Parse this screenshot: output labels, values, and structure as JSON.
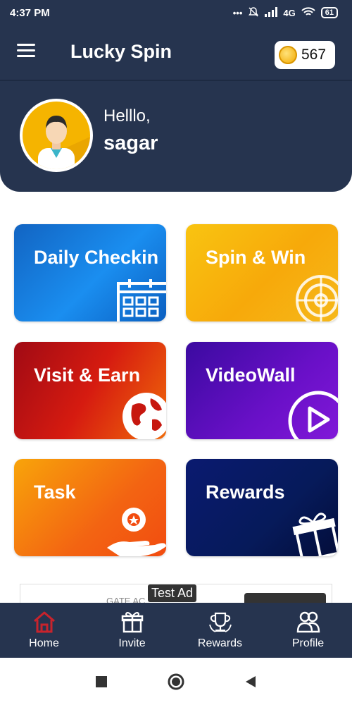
{
  "status_bar": {
    "time": "4:37 PM",
    "network": "4G",
    "battery": "61"
  },
  "header": {
    "title": "Lucky Spin",
    "coins": "567",
    "greeting": "Helllo,",
    "username": "sagar"
  },
  "cards": [
    {
      "label": "Daily Checkin",
      "icon": "calendar-icon"
    },
    {
      "label": "Spin & Win",
      "icon": "wheel-icon"
    },
    {
      "label": "Visit & Earn",
      "icon": "globe-icon"
    },
    {
      "label": "VideoWall",
      "icon": "play-icon"
    },
    {
      "label": "Task",
      "icon": "hand-badge-icon"
    },
    {
      "label": "Rewards",
      "icon": "gift-icon"
    }
  ],
  "ad": {
    "badge": "Test Ad",
    "text": "GATE AC"
  },
  "bottom_nav": [
    {
      "label": "Home",
      "icon": "home-icon",
      "active": true
    },
    {
      "label": "Invite",
      "icon": "gift-icon",
      "active": false
    },
    {
      "label": "Rewards",
      "icon": "trophy-icon",
      "active": false
    },
    {
      "label": "Profile",
      "icon": "users-icon",
      "active": false
    }
  ],
  "colors": {
    "header_bg": "#26344f",
    "active_nav": "#c8232c",
    "coin": "#f2a900"
  }
}
